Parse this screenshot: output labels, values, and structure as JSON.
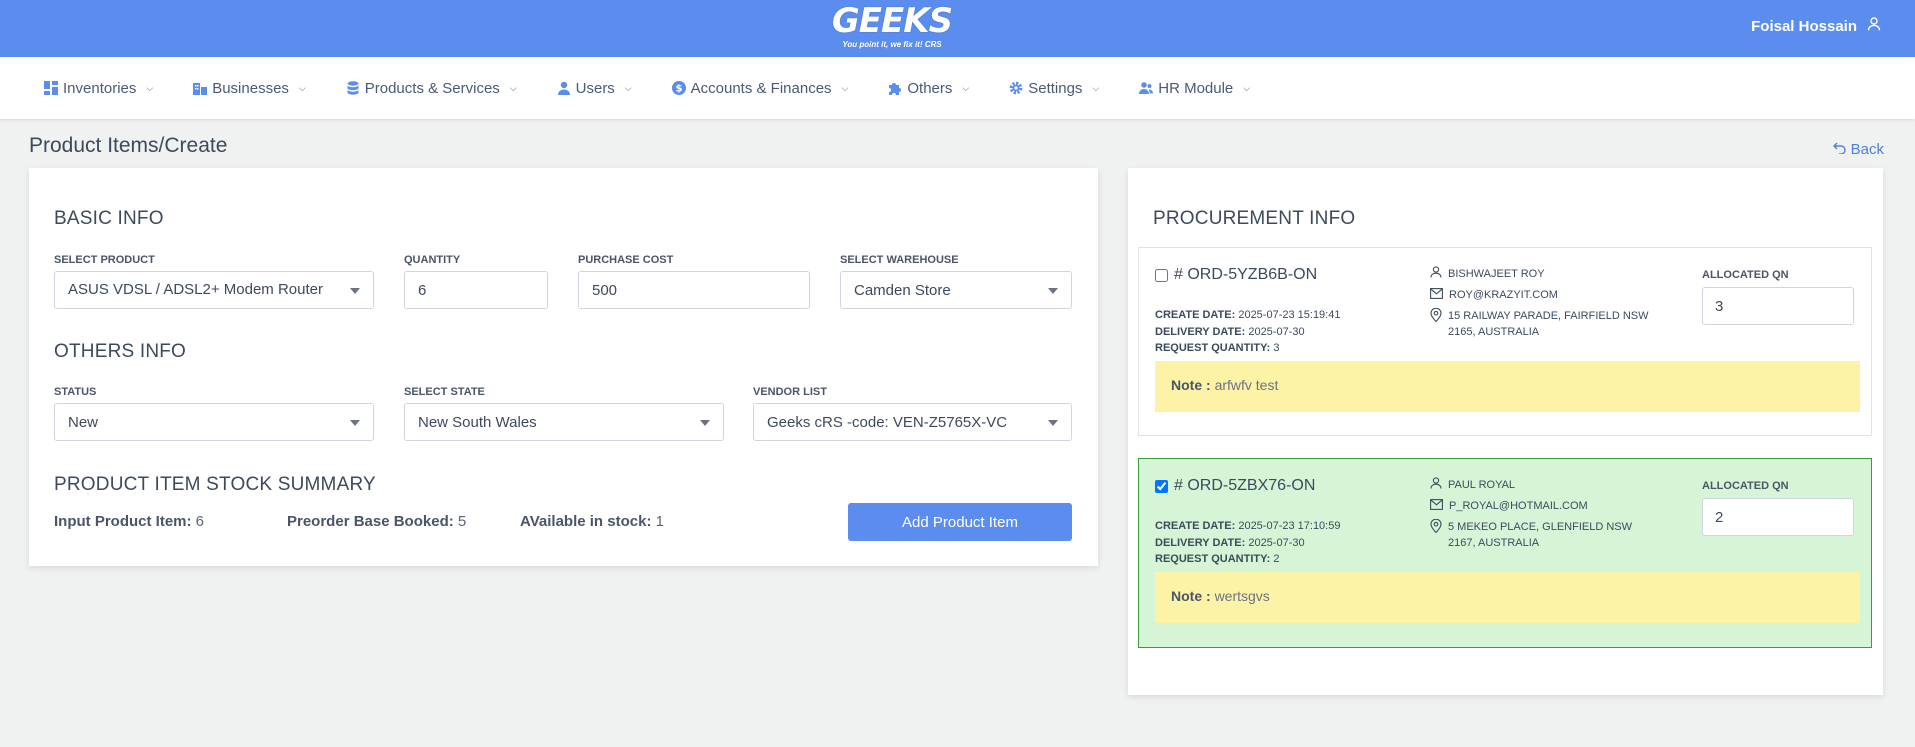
{
  "header": {
    "logo_text": "GEEKS",
    "logo_tagline": "You point it, we fix it! CRS",
    "user_name": "Foisal Hossain"
  },
  "nav": {
    "items": [
      {
        "label": "Inventories",
        "icon": "grid-icon"
      },
      {
        "label": "Businesses",
        "icon": "building-icon"
      },
      {
        "label": "Products & Services",
        "icon": "database-icon"
      },
      {
        "label": "Users",
        "icon": "user-icon"
      },
      {
        "label": "Accounts & Finances",
        "icon": "dollar-circle-icon"
      },
      {
        "label": "Others",
        "icon": "puzzle-icon"
      },
      {
        "label": "Settings",
        "icon": "gear-icon"
      },
      {
        "label": "HR Module",
        "icon": "users-icon"
      }
    ]
  },
  "page": {
    "title": "Product Items/Create",
    "back_label": "Back"
  },
  "basic_info": {
    "title": "BASIC INFO",
    "select_product_label": "SELECT PRODUCT",
    "select_product_value": "ASUS VDSL / ADSL2+ Modem Router",
    "quantity_label": "QUANTITY",
    "quantity_value": "6",
    "purchase_cost_label": "PURCHASE COST",
    "purchase_cost_value": "500",
    "warehouse_label": "SELECT WAREHOUSE",
    "warehouse_value": "Camden Store"
  },
  "others_info": {
    "title": "OTHERS INFO",
    "status_label": "STATUS",
    "status_value": "New",
    "state_label": "SELECT STATE",
    "state_value": "New South Wales",
    "vendor_label": "VENDOR LIST",
    "vendor_value": "Geeks cRS -code: VEN-Z5765X-VC"
  },
  "summary": {
    "title": "PRODUCT ITEM STOCK SUMMARY",
    "input_label": "Input Product Item:",
    "input_value": "6",
    "preorder_label": "Preorder Base Booked:",
    "preorder_value": "5",
    "available_label": "AVailable in stock:",
    "available_value": "1",
    "add_button": "Add Product Item"
  },
  "procurement": {
    "title": "PROCUREMENT INFO",
    "orders": [
      {
        "id": "# ORD-5YZB6B-ON",
        "checked": false,
        "create_date_label": "CREATE DATE:",
        "create_date": "2025-07-23 15:19:41",
        "delivery_date_label": "DELIVERY DATE:",
        "delivery_date": "2025-07-30",
        "request_qty_label": "REQUEST QUANTITY:",
        "request_qty": "3",
        "name": "BISHWAJEET ROY",
        "email": "ROY@KRAZYIT.COM",
        "address": "15 RAILWAY PARADE, FAIRFIELD NSW 2165, AUSTRALIA",
        "alloc_label": "ALLOCATED QN",
        "alloc_value": "3",
        "note_label": "Note :",
        "note": "arfwfv test"
      },
      {
        "id": "# ORD-5ZBX76-ON",
        "checked": true,
        "create_date_label": "CREATE DATE:",
        "create_date": "2025-07-23 17:10:59",
        "delivery_date_label": "DELIVERY DATE:",
        "delivery_date": "2025-07-30",
        "request_qty_label": "REQUEST QUANTITY:",
        "request_qty": "2",
        "name": "PAUL ROYAL",
        "email": "P_ROYAL@HOTMAIL.COM",
        "address": "5 MEKEO PLACE, GLENFIELD NSW 2167, AUSTRALIA",
        "alloc_label": "ALLOCATED QN",
        "alloc_value": "2",
        "note_label": "Note :",
        "note": "wertsgvs"
      }
    ]
  },
  "colors": {
    "primary": "#5b8def",
    "selected_bg": "#d6f5d6",
    "selected_border": "#3d9a3d",
    "note_bg": "#fdf3a6"
  }
}
